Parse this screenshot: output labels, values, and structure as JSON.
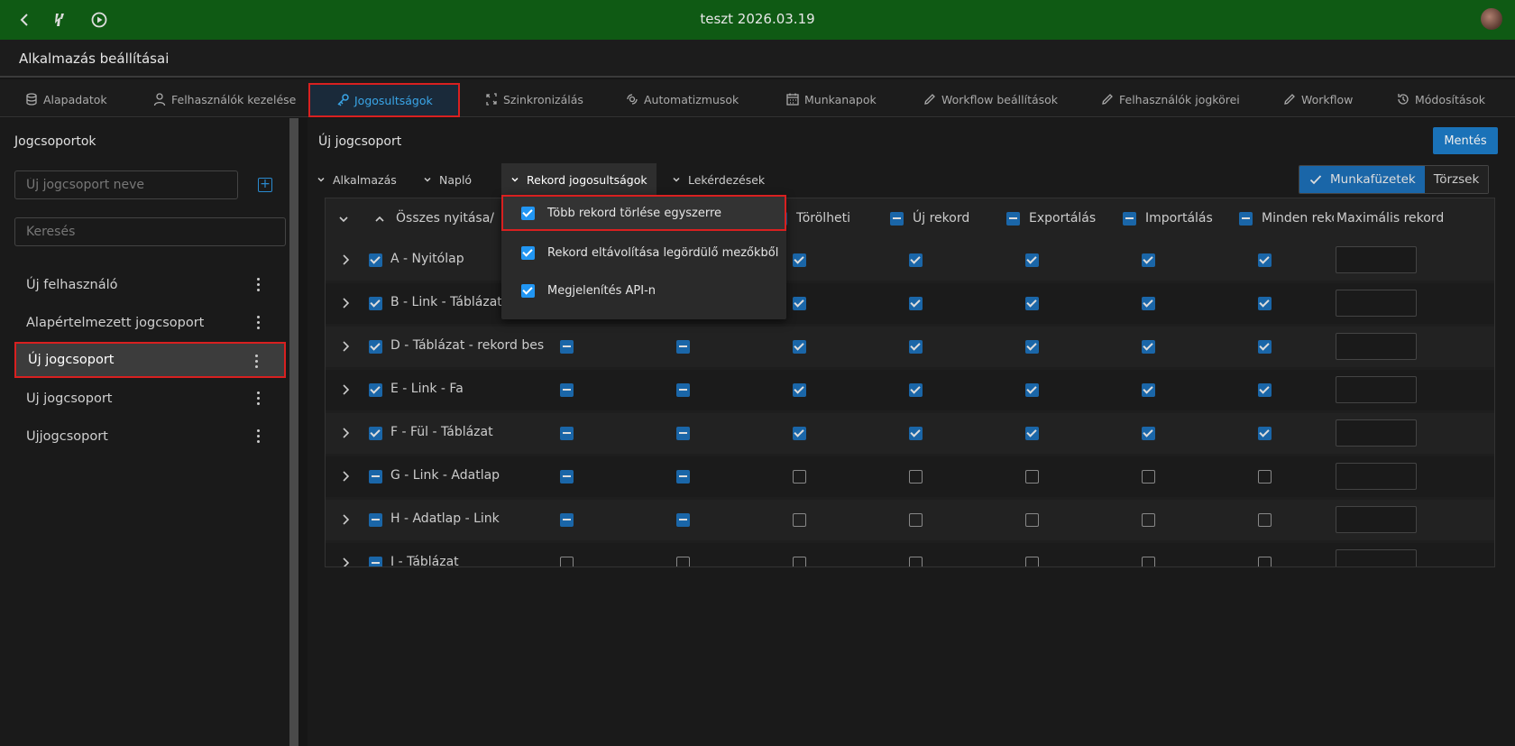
{
  "window": {
    "title": "teszt 2026.03.19"
  },
  "app": {
    "title": "Alkalmazás beállításai"
  },
  "tabs": [
    {
      "label": "Alapadatok",
      "icon": "database-icon"
    },
    {
      "label": "Felhasználók kezelése",
      "icon": "user-icon"
    },
    {
      "label": "Jogosultságok",
      "icon": "key-icon",
      "active": true
    },
    {
      "label": "Szinkronizálás",
      "icon": "sync-icon"
    },
    {
      "label": "Automatizmusok",
      "icon": "automation-icon"
    },
    {
      "label": "Munkanapok",
      "icon": "calendar-icon"
    },
    {
      "label": "Workflow beállítások",
      "icon": "pencil-icon"
    },
    {
      "label": "Felhasználók jogkörei",
      "icon": "pencil-icon"
    },
    {
      "label": "Workflow",
      "icon": "pencil-icon"
    },
    {
      "label": "Módosítások",
      "icon": "history-icon"
    }
  ],
  "sidebar": {
    "heading": "Jogcsoportok",
    "new_placeholder": "Új jogcsoport neve",
    "search_placeholder": "Keresés",
    "groups": [
      {
        "label": "Új felhasználó"
      },
      {
        "label": "Alapértelmezett jogcsoport"
      },
      {
        "label": "Új jogcsoport",
        "selected": true
      },
      {
        "label": "Uj jogcsoport"
      },
      {
        "label": "Ujjogcsoport"
      }
    ]
  },
  "main": {
    "heading": "Új jogcsoport",
    "save_label": "Mentés",
    "subtabs": [
      "Alkalmazás",
      "Napló",
      "Rekord jogosultságok",
      "Lekérdezések"
    ],
    "toggle": {
      "active": "Munkafüzetek",
      "inactive": "Törzsek"
    }
  },
  "table": {
    "columns": [
      "Összes nyitása/",
      "Törölheti",
      "Új rekord",
      "Exportálás",
      "Importálás",
      "Minden rekord",
      "Maximális rekord"
    ],
    "rows": [
      {
        "name": "A - Nyitólap",
        "name_cb": "chk",
        "cells": [
          "chk",
          "chk",
          "chk",
          "chk",
          "chk",
          "chk",
          "chk"
        ]
      },
      {
        "name": "B - Link - Táblázat",
        "name_cb": "chk",
        "cells": [
          "ind",
          "ind",
          "chk",
          "chk",
          "chk",
          "chk",
          "chk"
        ]
      },
      {
        "name": "D - Táblázat - rekord beszúrás",
        "name_cb": "chk",
        "cells": [
          "ind",
          "ind",
          "chk",
          "chk",
          "chk",
          "chk",
          "chk"
        ]
      },
      {
        "name": "E - Link - Fa",
        "name_cb": "chk",
        "cells": [
          "ind",
          "ind",
          "chk",
          "chk",
          "chk",
          "chk",
          "chk"
        ]
      },
      {
        "name": "F - Fül - Táblázat",
        "name_cb": "chk",
        "cells": [
          "ind",
          "ind",
          "chk",
          "chk",
          "chk",
          "chk",
          "chk"
        ]
      },
      {
        "name": "G - Link - Adatlap",
        "name_cb": "ind",
        "cells": [
          "ind",
          "ind",
          "emp",
          "emp",
          "emp",
          "emp",
          "emp"
        ]
      },
      {
        "name": "H - Adatlap - Link",
        "name_cb": "ind",
        "cells": [
          "ind",
          "ind",
          "emp",
          "emp",
          "emp",
          "emp",
          "emp"
        ]
      },
      {
        "name": "I - Táblázat",
        "name_cb": "ind",
        "cells": [
          "emp",
          "emp",
          "emp",
          "emp",
          "emp",
          "emp",
          "emp"
        ]
      }
    ]
  },
  "dropdown": {
    "items": [
      {
        "label": "Több rekord törlése egyszerre",
        "checked": true,
        "highlighted": true
      },
      {
        "label": "Rekord eltávolítása legördülő mezőkből",
        "checked": true
      },
      {
        "label": "Megjelenítés API-n",
        "checked": true
      }
    ]
  },
  "colors": {
    "topbar": "#0f5a14",
    "accent": "#1a66a8",
    "highlight": "#d82020"
  }
}
